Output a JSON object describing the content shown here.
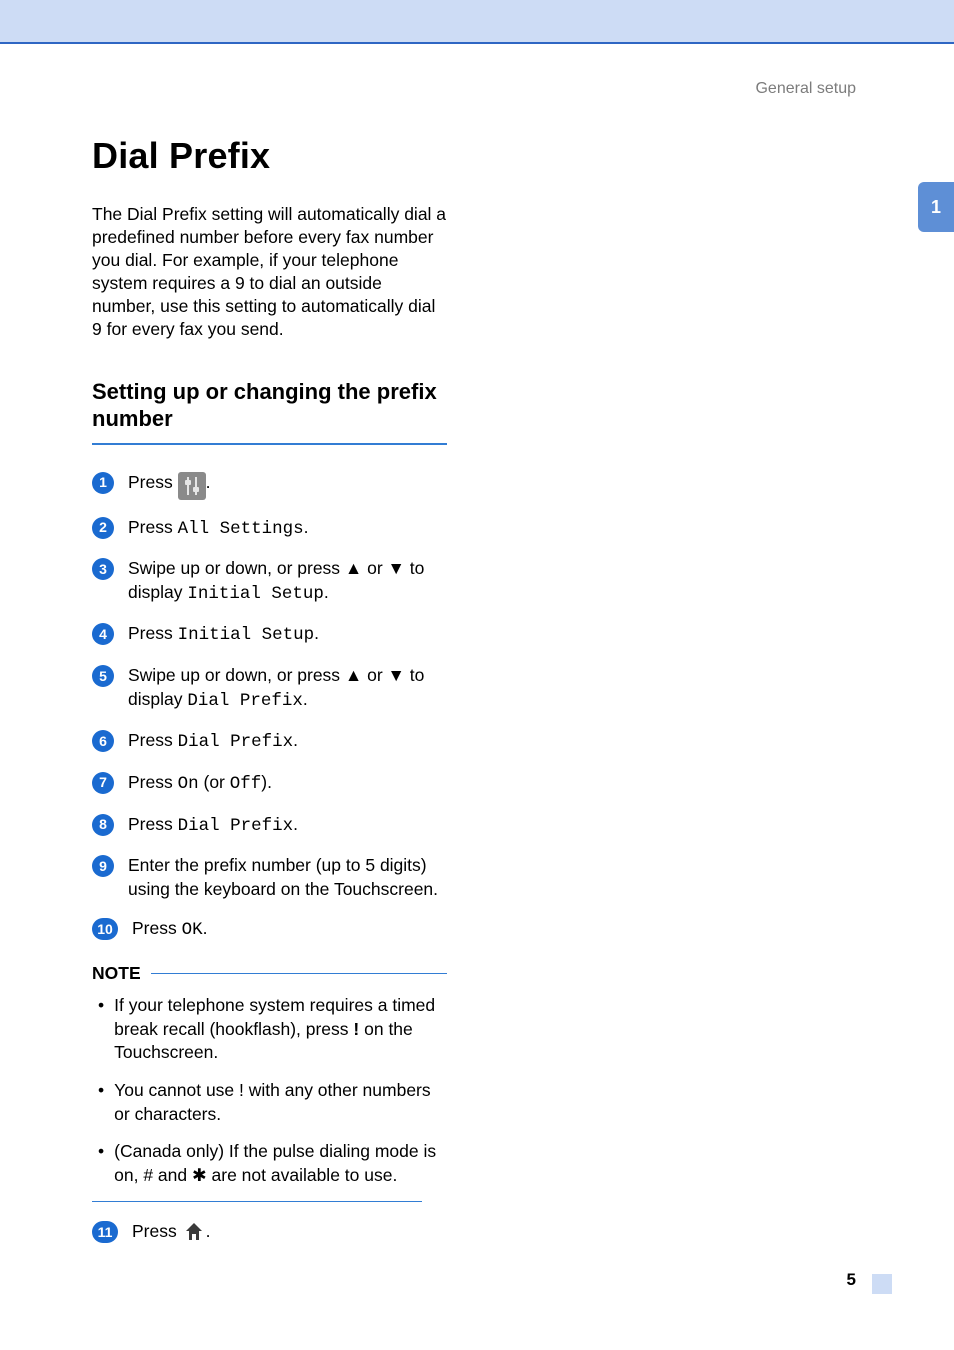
{
  "header": {
    "section": "General setup"
  },
  "title": "Dial Prefix",
  "intro": "The Dial Prefix setting will automatically dial a predefined number before every fax number you dial. For example, if your telephone system requires a 9 to dial an outside number, use this setting to automatically dial 9 for every fax you send.",
  "subhead": "Setting up or changing the prefix number",
  "steps": {
    "s1_pre": "Press ",
    "s1_post": ".",
    "s2_pre": "Press ",
    "s2_mono": "All Settings",
    "s2_post": ".",
    "s3_pre": "Swipe up or down, or press ",
    "s3_up": "▲",
    "s3_mid": " or ",
    "s3_down": "▼",
    "s3_mid2": " to display ",
    "s3_mono": "Initial Setup",
    "s3_post": ".",
    "s4_pre": "Press ",
    "s4_mono": "Initial Setup",
    "s4_post": ".",
    "s5_pre": "Swipe up or down, or press ",
    "s5_up": "▲",
    "s5_mid": " or ",
    "s5_down": "▼",
    "s5_mid2": " to display ",
    "s5_mono": "Dial Prefix",
    "s5_post": ".",
    "s6_pre": "Press ",
    "s6_mono": "Dial Prefix",
    "s6_post": ".",
    "s7_pre": "Press ",
    "s7_mono1": "On",
    "s7_mid": " (or ",
    "s7_mono2": "Off",
    "s7_post": ").",
    "s8_pre": "Press ",
    "s8_mono": "Dial Prefix",
    "s8_post": ".",
    "s9": "Enter the prefix number (up to 5 digits) using the keyboard on the Touchscreen.",
    "s10_pre": "Press ",
    "s10_mono": "OK",
    "s10_post": ".",
    "s11_pre": "Press ",
    "s11_post": "."
  },
  "note_label": "NOTE",
  "notes": {
    "n1_a": "If your telephone system requires a timed break recall (hookflash), press ",
    "n1_b": "!",
    "n1_c": " on the Touchscreen.",
    "n2": "You cannot use ! with any other numbers or characters.",
    "n3": "(Canada only) If the pulse dialing mode is on, # and ✱ are not available to use."
  },
  "chapter": "1",
  "page_number": "5",
  "badges": {
    "b1": "1",
    "b2": "2",
    "b3": "3",
    "b4": "4",
    "b5": "5",
    "b6": "6",
    "b7": "7",
    "b8": "8",
    "b9": "9",
    "b10": "10",
    "b11": "11"
  }
}
